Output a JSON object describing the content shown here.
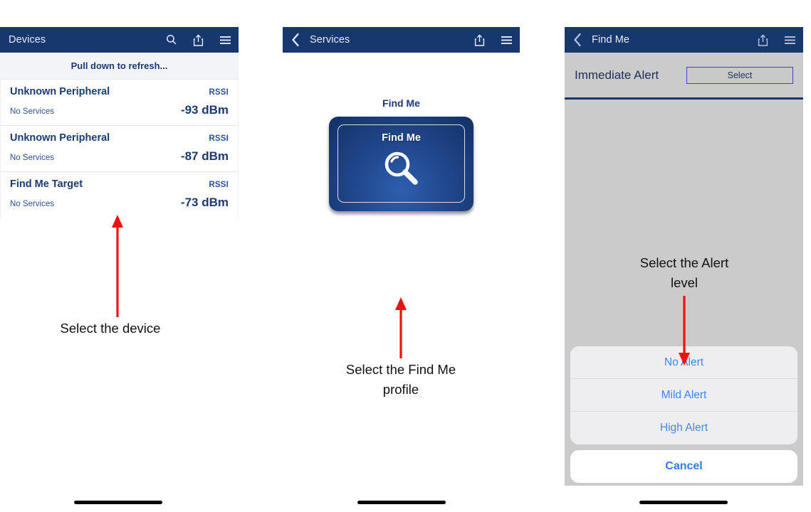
{
  "colors": {
    "navy": "#17386f",
    "navy_text": "#1c3a72",
    "panel_gray": "#cbcbcb",
    "ios_blue": "#3f86f7",
    "annotation_red": "#ee1111",
    "select_border": "#3f3fcd"
  },
  "panels": {
    "devices": {
      "navbar": {
        "title": "Devices",
        "icons": [
          "search-icon",
          "share-icon",
          "hamburger-menu-icon"
        ]
      },
      "refresh_hint": "Pull down to refresh...",
      "rssi_column_header": "RSSI",
      "rows": [
        {
          "name": "Unknown Peripheral",
          "rssi_label": "RSSI",
          "services": "No Services",
          "rssi_value": "-93 dBm"
        },
        {
          "name": "Unknown Peripheral",
          "rssi_label": "RSSI",
          "services": "No Services",
          "rssi_value": "-87 dBm"
        },
        {
          "name": "Find Me Target",
          "rssi_label": "RSSI",
          "services": "No Services",
          "rssi_value": "-73 dBm"
        }
      ]
    },
    "services": {
      "navbar": {
        "title": "Services",
        "back": "back-chevron-icon",
        "icons": [
          "share-icon",
          "hamburger-menu-icon"
        ]
      },
      "profile": {
        "caption": "Find Me",
        "tile_label": "Find Me",
        "tile_icon": "magnifier-icon"
      }
    },
    "findme": {
      "navbar": {
        "title": "Find Me",
        "back": "back-chevron-icon",
        "icons": [
          "share-icon",
          "hamburger-menu-icon"
        ]
      },
      "alert_row": {
        "label": "Immediate Alert",
        "select_button": "Select"
      },
      "action_sheet": {
        "options": [
          "No Alert",
          "Mild Alert",
          "High Alert"
        ],
        "cancel": "Cancel"
      }
    }
  },
  "annotations": [
    {
      "id": "a1",
      "text": "Select the device",
      "direction": "up"
    },
    {
      "id": "a2",
      "text": "Select the Find Me\nprofile",
      "direction": "up"
    },
    {
      "id": "a3",
      "text": "Select the Alert\nlevel",
      "direction": "down"
    }
  ]
}
